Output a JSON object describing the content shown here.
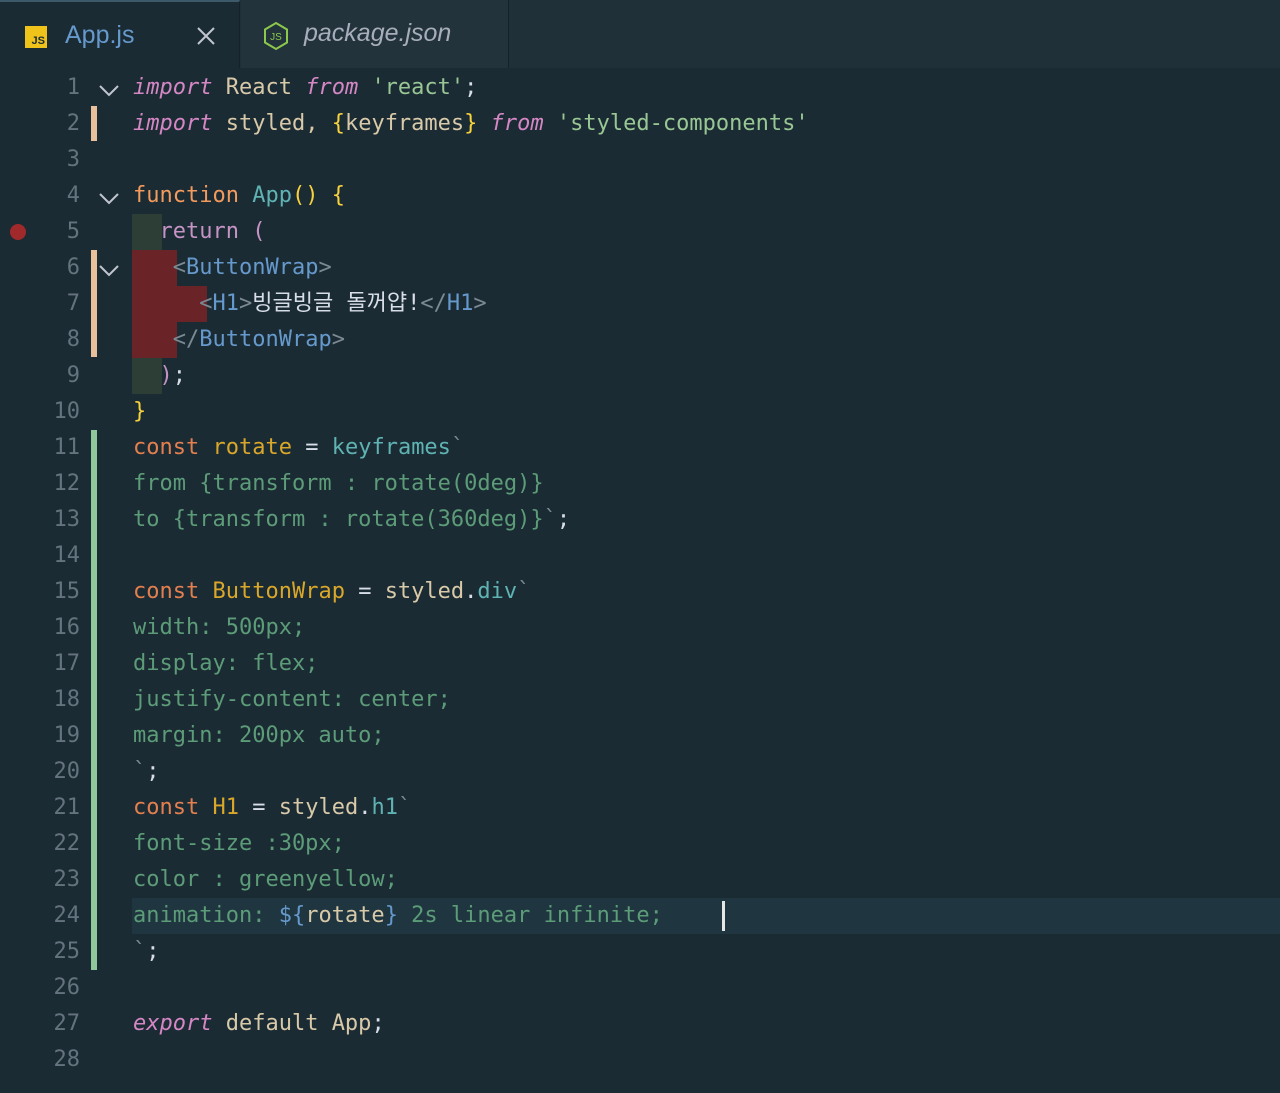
{
  "tabs": [
    {
      "label": "App.js",
      "icon": "js-file-icon",
      "active": true,
      "close_label": "×"
    },
    {
      "label": "package.json",
      "icon": "nodejs-icon",
      "active": false
    }
  ],
  "js_badge": "JS",
  "colors": {
    "background": "#1b2b34",
    "keyword": "#f39a5d",
    "string": "#99c794",
    "css_text": "#5c9c78",
    "breakpoint": "#a0292b",
    "git_added": "#8fc99b",
    "git_modified": "#e8c19c"
  },
  "editor": {
    "lines": [
      {
        "n": "1",
        "tokens": [
          [
            "kw-it",
            "import"
          ],
          [
            "id",
            " React "
          ],
          [
            "kw-it",
            "from"
          ],
          [
            "id",
            " "
          ],
          [
            "str",
            "'react'"
          ],
          [
            "white",
            ";"
          ]
        ]
      },
      {
        "n": "2",
        "tokens": [
          [
            "kw-it",
            "import"
          ],
          [
            "id",
            " styled, "
          ],
          [
            "brace",
            "{"
          ],
          [
            "id",
            "keyframes"
          ],
          [
            "brace",
            "}"
          ],
          [
            "id",
            " "
          ],
          [
            "kw-it",
            "from"
          ],
          [
            "id",
            " "
          ],
          [
            "str",
            "'styled-components'"
          ]
        ]
      },
      {
        "n": "3",
        "tokens": []
      },
      {
        "n": "4",
        "tokens": [
          [
            "kw",
            "function"
          ],
          [
            "id",
            " "
          ],
          [
            "fn",
            "App"
          ],
          [
            "brace",
            "()"
          ],
          [
            "id",
            " "
          ],
          [
            "brace",
            "{"
          ]
        ]
      },
      {
        "n": "5",
        "tokens": [
          [
            "id",
            "  "
          ],
          [
            "kw-pink",
            "return"
          ],
          [
            "id",
            " "
          ],
          [
            "kw-pink",
            "("
          ]
        ]
      },
      {
        "n": "6",
        "tokens": [
          [
            "id",
            "   "
          ],
          [
            "dim",
            "<"
          ],
          [
            "tag",
            "ButtonWrap"
          ],
          [
            "dim",
            ">"
          ]
        ]
      },
      {
        "n": "7",
        "tokens": [
          [
            "id",
            "     "
          ],
          [
            "dim",
            "<"
          ],
          [
            "tag",
            "H1"
          ],
          [
            "dim",
            ">"
          ],
          [
            "white",
            "빙글빙글 돌꺼얍!"
          ],
          [
            "dim",
            "</"
          ],
          [
            "tag",
            "H1"
          ],
          [
            "dim",
            ">"
          ]
        ]
      },
      {
        "n": "8",
        "tokens": [
          [
            "id",
            "   "
          ],
          [
            "dim",
            "</"
          ],
          [
            "tag",
            "ButtonWrap"
          ],
          [
            "dim",
            ">"
          ]
        ]
      },
      {
        "n": "9",
        "tokens": [
          [
            "id",
            "  "
          ],
          [
            "kw-pink",
            ")"
          ],
          [
            "white",
            ";"
          ]
        ]
      },
      {
        "n": "10",
        "tokens": [
          [
            "brace",
            "}"
          ]
        ]
      },
      {
        "n": "11",
        "tokens": [
          [
            "const",
            "const"
          ],
          [
            "id",
            " "
          ],
          [
            "yellow",
            "rotate"
          ],
          [
            "id",
            " "
          ],
          [
            "white",
            "="
          ],
          [
            "id",
            " "
          ],
          [
            "fn",
            "keyframes"
          ],
          [
            "dim",
            "`"
          ]
        ]
      },
      {
        "n": "12",
        "tokens": [
          [
            "css",
            "from {transform : rotate(0deg)}"
          ]
        ]
      },
      {
        "n": "13",
        "tokens": [
          [
            "css",
            "to {transform : rotate(360deg)}"
          ],
          [
            "dim",
            "`"
          ],
          [
            "white",
            ";"
          ]
        ]
      },
      {
        "n": "14",
        "tokens": []
      },
      {
        "n": "15",
        "tokens": [
          [
            "const",
            "const"
          ],
          [
            "id",
            " "
          ],
          [
            "yellow",
            "ButtonWrap"
          ],
          [
            "id",
            " "
          ],
          [
            "white",
            "="
          ],
          [
            "id",
            " "
          ],
          [
            "id",
            "styled"
          ],
          [
            "white",
            "."
          ],
          [
            "fn",
            "div"
          ],
          [
            "dim",
            "`"
          ]
        ]
      },
      {
        "n": "16",
        "tokens": [
          [
            "css",
            "width: 500px;"
          ]
        ]
      },
      {
        "n": "17",
        "tokens": [
          [
            "css",
            "display: flex;"
          ]
        ]
      },
      {
        "n": "18",
        "tokens": [
          [
            "css",
            "justify-content: center;"
          ]
        ]
      },
      {
        "n": "19",
        "tokens": [
          [
            "css",
            "margin: 200px auto;"
          ]
        ]
      },
      {
        "n": "20",
        "tokens": [
          [
            "dim",
            "`"
          ],
          [
            "white",
            ";"
          ]
        ]
      },
      {
        "n": "21",
        "tokens": [
          [
            "const",
            "const"
          ],
          [
            "id",
            " "
          ],
          [
            "yellow",
            "H1"
          ],
          [
            "id",
            " "
          ],
          [
            "white",
            "="
          ],
          [
            "id",
            " "
          ],
          [
            "id",
            "styled"
          ],
          [
            "white",
            "."
          ],
          [
            "fn",
            "h1"
          ],
          [
            "dim",
            "`"
          ]
        ]
      },
      {
        "n": "22",
        "tokens": [
          [
            "css",
            "font-size :30px;"
          ]
        ]
      },
      {
        "n": "23",
        "tokens": [
          [
            "css",
            "color : greenyellow;"
          ]
        ]
      },
      {
        "n": "24",
        "tokens": [
          [
            "css",
            "animation: "
          ],
          [
            "blue",
            "${"
          ],
          [
            "id",
            "rotate"
          ],
          [
            "blue",
            "}"
          ],
          [
            "css",
            " 2s linear infinite;"
          ]
        ]
      },
      {
        "n": "25",
        "tokens": [
          [
            "dim",
            "`"
          ],
          [
            "white",
            ";"
          ]
        ]
      },
      {
        "n": "26",
        "tokens": []
      },
      {
        "n": "27",
        "tokens": [
          [
            "kw-it",
            "export"
          ],
          [
            "id",
            " default App"
          ],
          [
            "white",
            ";"
          ]
        ]
      },
      {
        "n": "28",
        "tokens": []
      }
    ]
  }
}
